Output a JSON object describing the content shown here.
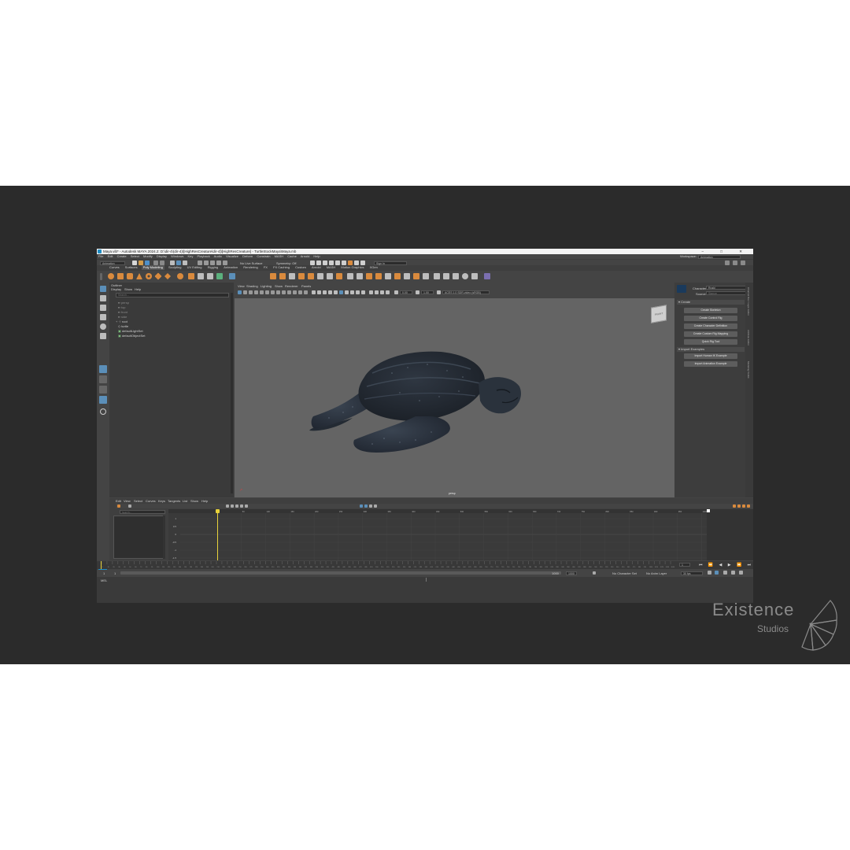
{
  "window": {
    "title": "Maya.vib* - Autodesk MAYA 2024.2: D:\\dir-4\\(dir-4)\\[HighResCreature\\dir-4]\\[HighResCreature] - TurtleStockMaya\\Maya.mb",
    "controls": "–  □  ✕"
  },
  "menu": [
    "File",
    "Edit",
    "Create",
    "Select",
    "Modify",
    "Display",
    "Windows",
    "Key",
    "Playback",
    "Audio",
    "Visualize",
    "Deform",
    "Constrain",
    "MASH",
    "Cache",
    "Arnold",
    "Help"
  ],
  "workspace": {
    "label": "Workspace:",
    "value": "Animation"
  },
  "status_line": {
    "mode": "Animation",
    "live_surface": "No Live Surface",
    "symmetry": "Symmetry: Off",
    "sign_in": "Sign In"
  },
  "shelf_tabs": [
    "Curves",
    "Surfaces",
    "Poly Modeling",
    "Sculpting",
    "UV Editing",
    "Rigging",
    "Animation",
    "Rendering",
    "FX",
    "FX Caching",
    "Custom",
    "Arnold",
    "MASH",
    "Motion Graphics",
    "XGen"
  ],
  "outliner": {
    "title": "Outliner",
    "menus": [
      "Display",
      "Show",
      "Help"
    ],
    "search_placeholder": "Search...",
    "items": [
      "persp",
      "top",
      "front",
      "side",
      "root",
      "turtle",
      "defaultLightSet",
      "defaultObjectSet"
    ]
  },
  "viewport": {
    "menus": [
      "View",
      "Shading",
      "Lighting",
      "Show",
      "Renderer",
      "Panels"
    ],
    "exposure": "0.00",
    "gamma": "1.00",
    "color_space": "ACES 1.0 SDR-video (sRGB)",
    "camera_label": "persp",
    "viewcube_label": "FRONT"
  },
  "character_controls": {
    "character_label": "Character:",
    "character_value": "Ruski",
    "source_label": "Source:",
    "source_value": "Stance",
    "sections": [
      {
        "title": "Create",
        "buttons": [
          "Create Skeleton",
          "Create Control Rig",
          "Create Character Definition",
          "Create Custom Rig Mapping",
          "Quick Rig Tool"
        ]
      },
      {
        "title": "Import Examples",
        "buttons": [
          "Import Human IK Example",
          "Import Animation Example"
        ]
      }
    ],
    "side_tabs": [
      "Channel Box / Layer Editor",
      "Attribute Editor",
      "Modeling Toolkit"
    ]
  },
  "graph_editor": {
    "menus": [
      "Edit",
      "View",
      "Select",
      "Curves",
      "Keys",
      "Tangents",
      "List",
      "Show",
      "Help"
    ],
    "search_placeholder": "Search...",
    "y_values": [
      "1",
      "0.5",
      "0",
      "-0.5",
      "-1",
      "-1.5"
    ],
    "x_ticks": [
      "1",
      "50",
      "100",
      "150",
      "200",
      "250",
      "300",
      "350",
      "400",
      "450",
      "500",
      "550",
      "600",
      "650",
      "700",
      "750",
      "800",
      "850",
      "900",
      "950",
      "1000"
    ]
  },
  "timeline": {
    "ticks": [
      "1",
      "10",
      "20",
      "30",
      "40",
      "50",
      "60",
      "70",
      "80",
      "90",
      "100",
      "110",
      "120",
      "130",
      "140",
      "150",
      "160",
      "170",
      "180",
      "190",
      "200",
      "210",
      "220",
      "230",
      "240",
      "250",
      "260",
      "270",
      "280",
      "290",
      "300",
      "310",
      "320",
      "330",
      "340",
      "350",
      "360",
      "370",
      "380",
      "390",
      "400",
      "410",
      "420",
      "430",
      "440",
      "450",
      "460",
      "470",
      "480",
      "490",
      "500",
      "510",
      "520",
      "530",
      "540",
      "550",
      "560",
      "570",
      "580",
      "590",
      "600",
      "610",
      "620",
      "630",
      "640",
      "650",
      "660",
      "670",
      "680",
      "690",
      "700",
      "710",
      "720",
      "730",
      "740",
      "750",
      "760",
      "770",
      "780",
      "790",
      "800",
      "810",
      "820",
      "830",
      "840",
      "850",
      "860",
      "870",
      "880",
      "890",
      "900",
      "910",
      "920",
      "930",
      "940",
      "950",
      "960",
      "970",
      "980",
      "990",
      "1000",
      "1010",
      "1020",
      "1030",
      "1040"
    ],
    "current_frame": "1",
    "range_start": "1",
    "range_inner_start": "1",
    "range_inner_end": "1000",
    "range_end": "1000",
    "character_set": "No Character Set",
    "anim_layer": "No Anim Layer",
    "fps": "30 fps"
  },
  "command_line": {
    "label": "MEL"
  },
  "watermark": {
    "line1": "Existence",
    "line2": "Studios"
  },
  "colors": {
    "band": "#2b2b2b",
    "maya_bg": "#444444",
    "viewport": "#646464",
    "accent_orange": "#d98a3d",
    "highlight_blue": "#5b8fb9",
    "playhead": "#e8d23a"
  }
}
